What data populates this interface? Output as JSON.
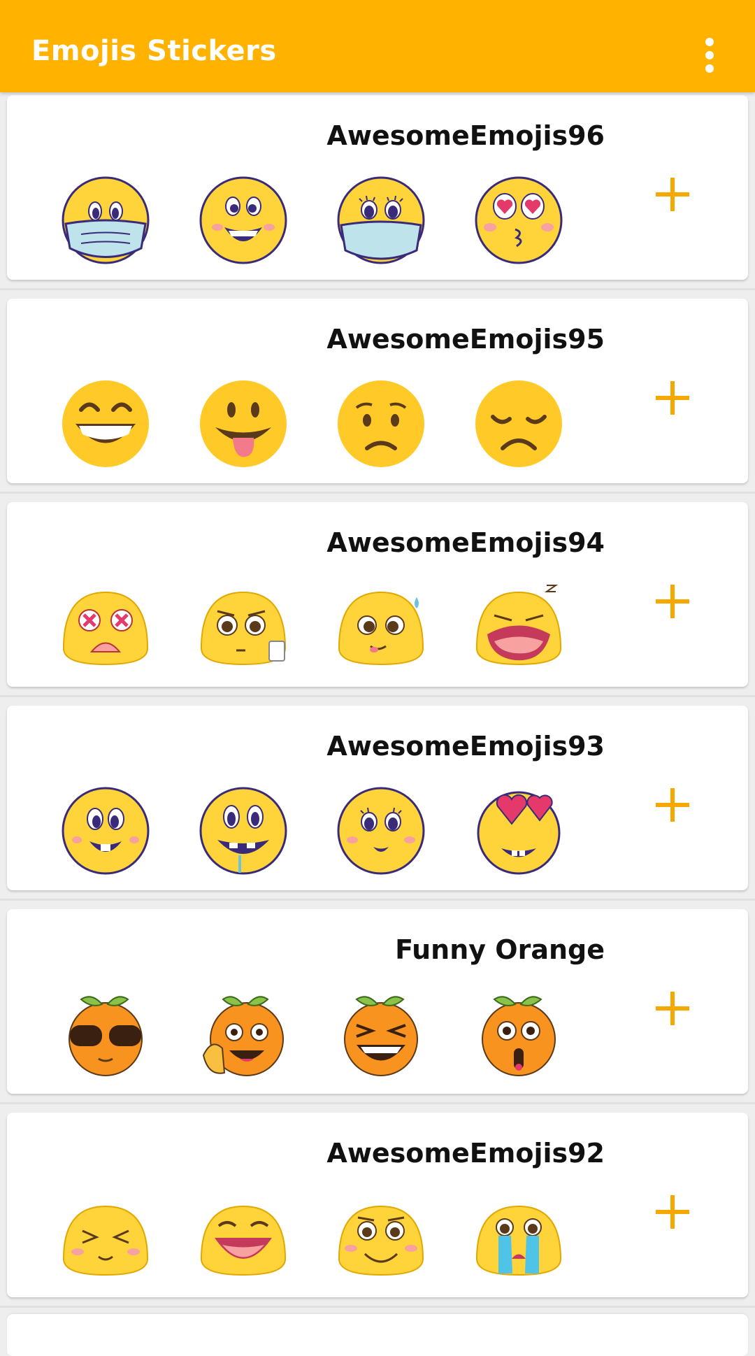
{
  "app_bar": {
    "title": "Emojis Stickers",
    "menu_icon": "more-vert-icon",
    "background_color": "#ffb300"
  },
  "sticker_packs": [
    {
      "name": "AwesomeEmojis96",
      "stickers": [
        "face-with-mask-sticker",
        "grinning-blush-sticker",
        "cute-mask-sticker",
        "heart-eyes-kiss-sticker"
      ],
      "add_icon": "plus-icon"
    },
    {
      "name": "AwesomeEmojis95",
      "stickers": [
        "big-grin-sticker",
        "tongue-out-sticker",
        "worried-sticker",
        "disappointed-sticker"
      ],
      "add_icon": "plus-icon"
    },
    {
      "name": "AwesomeEmojis94",
      "stickers": [
        "dizzy-x-eyes-sticker",
        "tired-coffee-sticker",
        "sweat-smile-sticker",
        "sleepy-yawn-sticker"
      ],
      "add_icon": "plus-icon"
    },
    {
      "name": "AwesomeEmojis93",
      "stickers": [
        "buck-tooth-grin-sticker",
        "drooling-sticker",
        "cute-smile-sticker",
        "heart-eyes-sticker"
      ],
      "add_icon": "plus-icon"
    },
    {
      "name": "Funny Orange",
      "stickers": [
        "orange-sunglasses-sticker",
        "orange-laughing-sticker",
        "orange-squint-laugh-sticker",
        "orange-surprised-sticker"
      ],
      "add_icon": "plus-icon"
    },
    {
      "name": "AwesomeEmojis92",
      "stickers": [
        "squint-smile-sticker",
        "laughing-sticker",
        "happy-blush-sticker",
        "crying-sticker"
      ],
      "add_icon": "plus-icon"
    }
  ],
  "colors": {
    "accent": "#ffb300",
    "plus": "#f5a900",
    "emoji_yellow": "#ffd43b",
    "outline_blue": "#3a2b7a",
    "orange": "#f7931e"
  }
}
